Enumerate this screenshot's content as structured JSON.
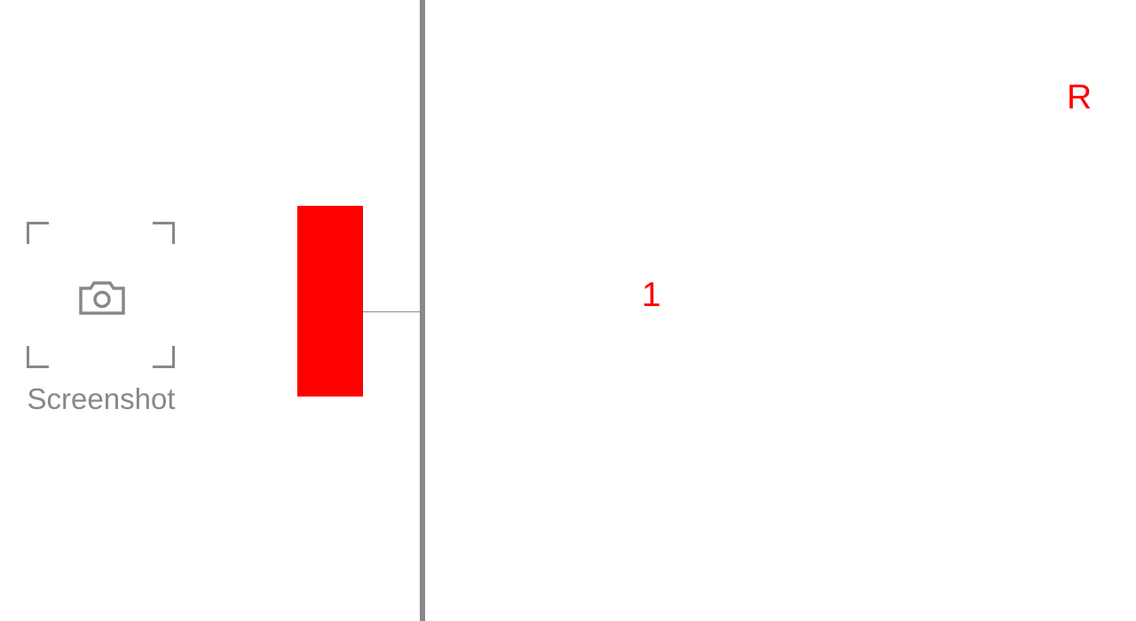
{
  "screenshot_tool": {
    "label": "Screenshot",
    "icon": "camera-icon",
    "color": "#888888"
  },
  "panel": {
    "accent_color": "#ff0000",
    "divider_color": "#888888"
  },
  "markers": {
    "corner_label": "R",
    "center_label": "1"
  }
}
